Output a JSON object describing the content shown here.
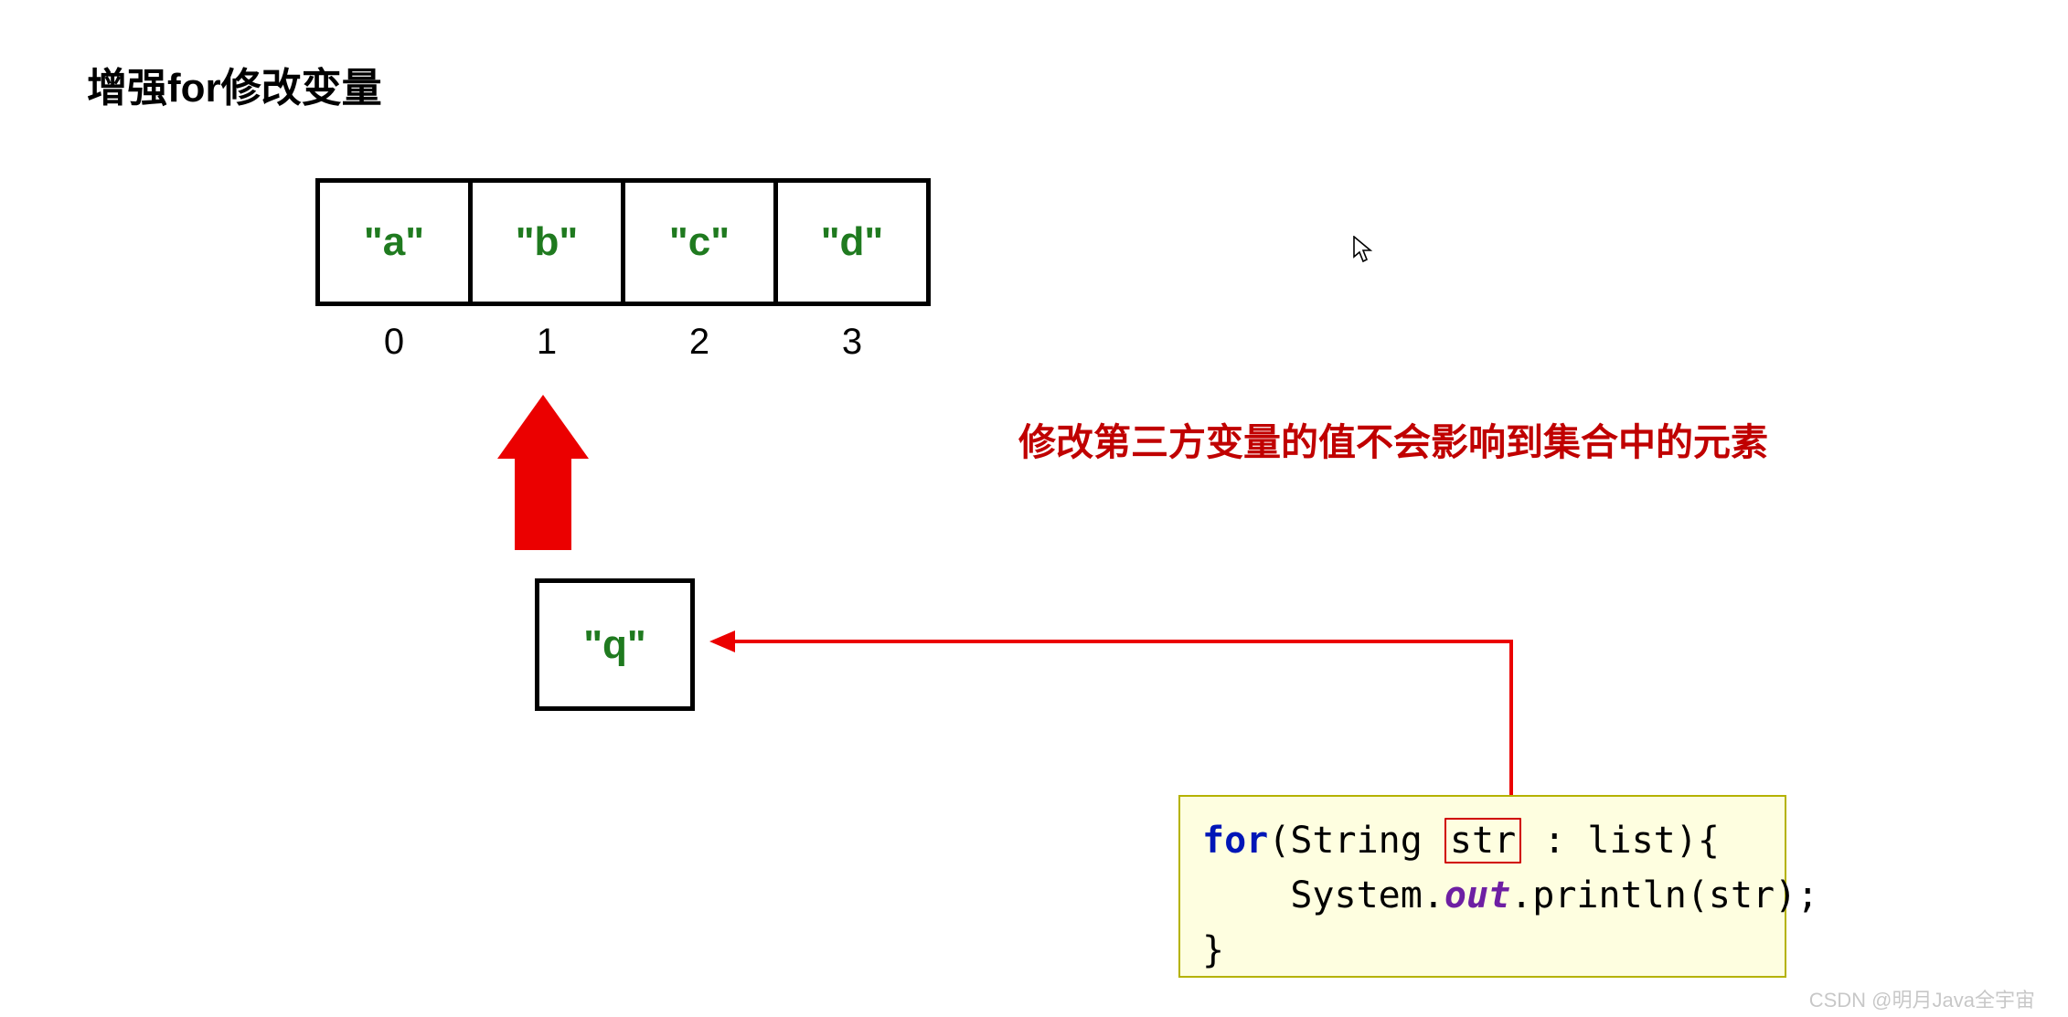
{
  "title": "增强for修改变量",
  "array": {
    "items": [
      "\"a\"",
      "\"b\"",
      "\"c\"",
      "\"d\""
    ],
    "indices": [
      "0",
      "1",
      "2",
      "3"
    ]
  },
  "qbox": "\"q\"",
  "note": "修改第三方变量的值不会影响到集合中的元素",
  "code": {
    "for_kw": "for",
    "sig_left": "(String ",
    "str_var": "str",
    "sig_right": " : list){",
    "line2_left": "    System.",
    "out_kw": "out",
    "line2_right": ".println(str);",
    "line3": "}"
  },
  "watermark": "CSDN @明月Java全宇宙"
}
